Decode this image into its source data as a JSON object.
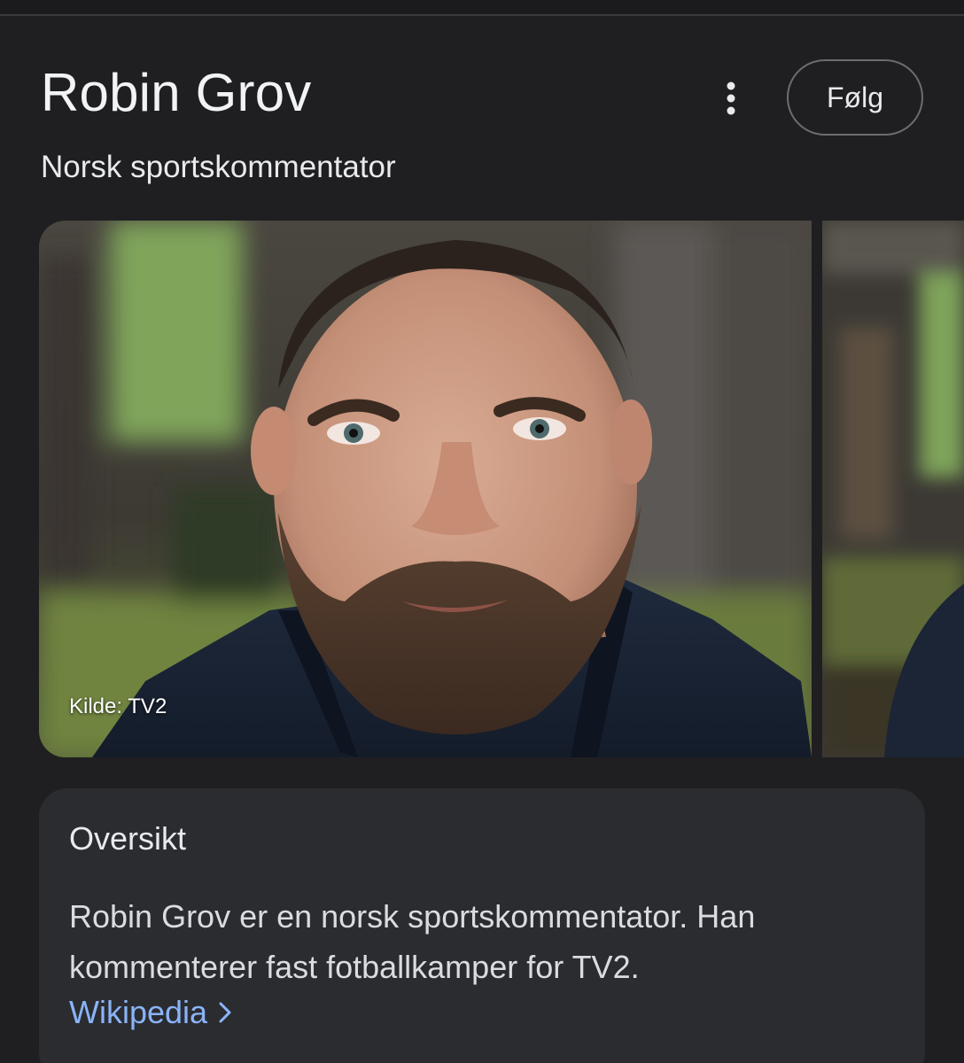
{
  "header": {
    "title": "Robin Grov",
    "subtitle": "Norsk sportskommentator",
    "follow_label": "Følg",
    "more_icon": "more-vert-icon"
  },
  "images": {
    "main_caption": "Kilde: TV2"
  },
  "overview": {
    "heading": "Oversikt",
    "text": "Robin Grov er en norsk sportskommentator. Han kommenterer fast fotballkamper for TV2.",
    "link_label": "Wikipedia",
    "link_icon": "chevron-right-icon"
  },
  "colors": {
    "background": "#1f1f21",
    "card": "#2b2c30",
    "link": "#8ab4f8",
    "text": "#e8eaed"
  }
}
